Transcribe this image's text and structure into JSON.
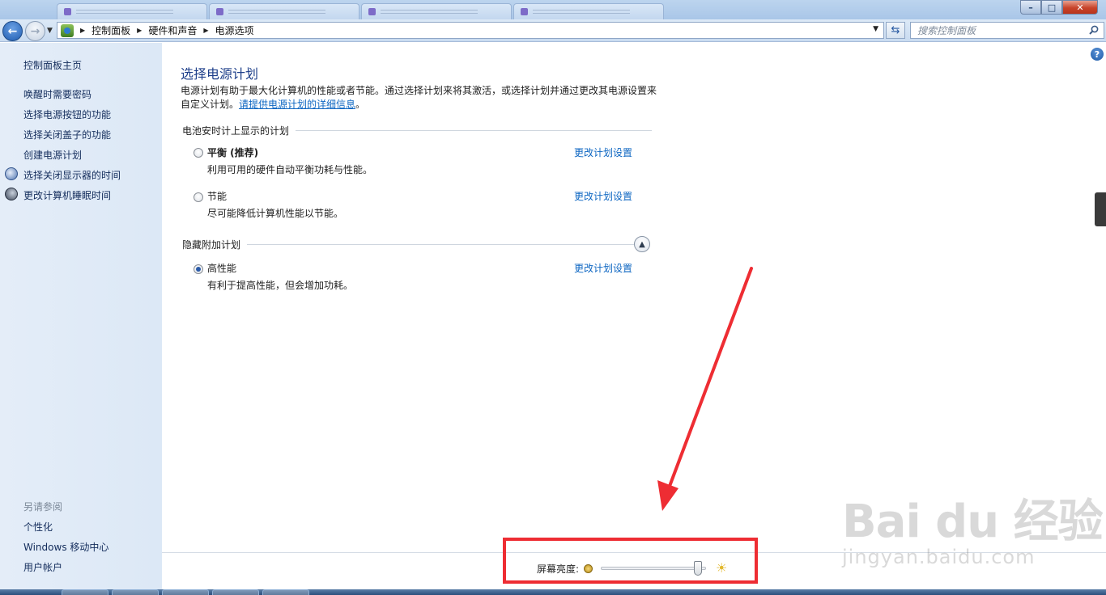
{
  "window": {
    "tabs": [
      "",
      "",
      "",
      ""
    ],
    "controls": {
      "minimize": "–",
      "maximize": "□",
      "close": "✕"
    }
  },
  "address_bar": {
    "breadcrumbs": [
      "控制面板",
      "硬件和声音",
      "电源选项"
    ],
    "search_placeholder": "搜索控制面板",
    "icons": [
      "back-icon",
      "forward-icon",
      "control-panel-icon",
      "refresh-icon",
      "search-icon"
    ]
  },
  "sidebar": {
    "home": "控制面板主页",
    "items": [
      {
        "label": "唤醒时需要密码",
        "icon": ""
      },
      {
        "label": "选择电源按钮的功能",
        "icon": ""
      },
      {
        "label": "选择关闭盖子的功能",
        "icon": ""
      },
      {
        "label": "创建电源计划",
        "icon": ""
      },
      {
        "label": "选择关闭显示器的时间",
        "icon": "monitor-clock-icon"
      },
      {
        "label": "更改计算机睡眠时间",
        "icon": "moon-icon"
      }
    ],
    "see_also_title": "另请参阅",
    "see_also": [
      "个性化",
      "Windows 移动中心",
      "用户帐户"
    ]
  },
  "main": {
    "title": "选择电源计划",
    "description": "电源计划有助于最大化计算机的性能或者节能。通过选择计划来将其激活，或选择计划并通过更改其电源设置来自定义计划。",
    "description_link": "请提供电源计划的详细信息",
    "description_end": "。",
    "battery_group_title": "电池安时计上显示的计划",
    "hidden_group_title": "隐藏附加计划",
    "plans": [
      {
        "name": "平衡 (推荐)",
        "desc": "利用可用的硬件自动平衡功耗与性能。",
        "link": "更改计划设置",
        "selected": false
      },
      {
        "name": "节能",
        "desc": "尽可能降低计算机性能以节能。",
        "link": "更改计划设置",
        "selected": false
      },
      {
        "name": "高性能",
        "desc": "有利于提高性能，但会增加功耗。",
        "link": "更改计划设置",
        "selected": true
      }
    ]
  },
  "brightness": {
    "label": "屏幕亮度:",
    "value_fraction": 0.95
  },
  "annotation": {
    "color": "#ee2d33"
  },
  "watermark": {
    "brand": "Bai du 经验",
    "url": "jingyan.baidu.com"
  },
  "colors": {
    "link": "#0d66c2",
    "title": "#1e3f8a",
    "sidebar_bg": "#dce8f6"
  }
}
